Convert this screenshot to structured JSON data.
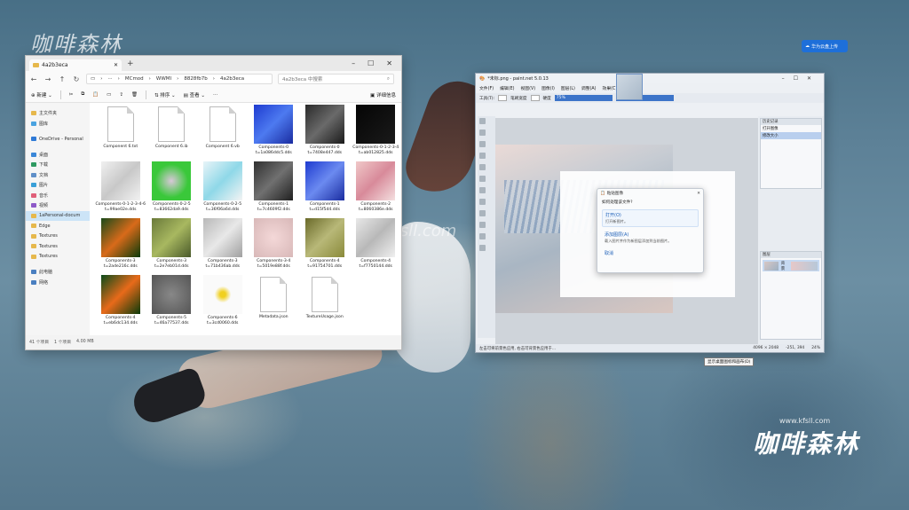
{
  "desktop": {
    "watermark_top_left": "咖啡森林",
    "watermark_center": "kfsll.com",
    "watermark_br_url": "www.kfsll.com",
    "watermark_br_name": "咖啡森林",
    "cloud_button": "华为云盘上传"
  },
  "explorer": {
    "tab_title": "4a2b3eca",
    "breadcrumb": [
      "MCmod",
      "WWMI",
      "8828fb7b",
      "4a2b3eca"
    ],
    "search_placeholder": "4a2b3eca 中搜索",
    "toolbar": {
      "new": "新建",
      "sort": "排序",
      "view": "查看",
      "details": "详细信息"
    },
    "nav": [
      {
        "label": "主文件夹",
        "color": "#e6b84c"
      },
      {
        "label": "图库",
        "color": "#4aa3e0"
      },
      {
        "label": "OneDrive - Personal",
        "color": "#2f7ad6"
      },
      {
        "label": "桌面",
        "color": "#3a87d8"
      },
      {
        "label": "下载",
        "color": "#2f9a62"
      },
      {
        "label": "文档",
        "color": "#5f8fc8"
      },
      {
        "label": "图片",
        "color": "#3aa0d8"
      },
      {
        "label": "音乐",
        "color": "#e0607a"
      },
      {
        "label": "视频",
        "color": "#8e5ac8"
      },
      {
        "label": "1aPersonal-docum",
        "color": "#e6b84c"
      },
      {
        "label": "Edge",
        "color": "#e6b84c"
      },
      {
        "label": "Textures",
        "color": "#e6b84c"
      },
      {
        "label": "Textures",
        "color": "#e6b84c"
      },
      {
        "label": "Textures",
        "color": "#e6b84c"
      },
      {
        "label": "此电脑",
        "color": "#4a7fc0"
      },
      {
        "label": "网络",
        "color": "#4a7fc0"
      }
    ],
    "files": [
      {
        "name": "Component 6.txt",
        "kind": "doc"
      },
      {
        "name": "Component 6.ib",
        "kind": "doc"
      },
      {
        "name": "Component 6.vb",
        "kind": "doc"
      },
      {
        "name": "Components-0 t=1a086ddc5.dds",
        "kind": "thumb",
        "bg": "linear-gradient(135deg,#1e3bd0,#4d7af0,#1a2ca0)"
      },
      {
        "name": "Components-0 t=7408e447.dds",
        "kind": "thumb",
        "bg": "linear-gradient(135deg,#2a2a2a,#6a6a6a,#1a1a1a)"
      },
      {
        "name": "Components-0-1-2-3-4 t=ab012825.dds",
        "kind": "thumb",
        "bg": "linear-gradient(135deg,#050505,#1a1a1a)"
      },
      {
        "name": "Components-0-1-2-3-4-6 t=99ae02e.dds",
        "kind": "thumb",
        "bg": "linear-gradient(135deg,#f0f0f0,#c8c8c8,#f2f2f2)"
      },
      {
        "name": "Components-0-2-5 t=83662da9.dds",
        "kind": "thumb",
        "bg": "radial-gradient(circle at 50% 50%,#d8c8d8,#3ac83a 60%)"
      },
      {
        "name": "Components-0-2-5 t=36f06a6d.dds",
        "kind": "thumb",
        "bg": "linear-gradient(135deg,#e8f4f8,#8fd8e8,#f4f4f4)"
      },
      {
        "name": "Components-1 t=7c4609f2.dds",
        "kind": "thumb",
        "bg": "linear-gradient(135deg,#303030,#707070,#202020)"
      },
      {
        "name": "Components-1 t=d15f5d4.dds",
        "kind": "thumb",
        "bg": "linear-gradient(135deg,#1e3bd0,#6b8af0,#1a2ca0)"
      },
      {
        "name": "Components-2 t=8060386e.dds",
        "kind": "thumb",
        "bg": "linear-gradient(135deg,#f0c8c8,#d88a9a,#f4e0e0)"
      },
      {
        "name": "Components-3 t=2ade216c.dds",
        "kind": "thumb",
        "bg": "linear-gradient(135deg,#1a4a1a,#d86a1a,#0a3a0a)"
      },
      {
        "name": "Components-3 t=2e7eb01d.dds",
        "kind": "thumb",
        "bg": "linear-gradient(135deg,#6a7a3a,#a8b860,#4a5a2a)"
      },
      {
        "name": "Components-3 t=71b436ab.dds",
        "kind": "thumb",
        "bg": "linear-gradient(135deg,#b8b8b8,#e8e8e8,#a0a0a0)"
      },
      {
        "name": "Components-3-4 t=5019e88f.dds",
        "kind": "thumb",
        "bg": "radial-gradient(circle,#f4d8d8,#d8b8b8)"
      },
      {
        "name": "Components-4 t=91754701.dds",
        "kind": "thumb",
        "bg": "linear-gradient(135deg,#6a6a2a,#b8b878,#8a8a3a)"
      },
      {
        "name": "Components-4 t=f7750144.dds",
        "kind": "thumb",
        "bg": "linear-gradient(135deg,#e8e8e8,#b8b8b8,#f0f0f0)"
      },
      {
        "name": "Components-4 t=eb6dc134.dds",
        "kind": "thumb",
        "bg": "linear-gradient(135deg,#0a4a1a,#e86a1a,#0a3a0a)"
      },
      {
        "name": "Components-5 t=46a77537.dds",
        "kind": "thumb",
        "bg": "radial-gradient(circle,#888,#555)"
      },
      {
        "name": "Components-6 t=3cd0060.dds",
        "kind": "thumb",
        "bg": "radial-gradient(circle,#f0d020 10%,#fafafa 30%)"
      },
      {
        "name": "Metadata.json",
        "kind": "doc"
      },
      {
        "name": "TextureUsage.json",
        "kind": "doc"
      }
    ],
    "status": [
      "41 个项目",
      "1 个项目",
      "4.00 MB"
    ]
  },
  "paint": {
    "title": "*未标.png - paint.net 5.0.13",
    "menu": [
      "文件(F)",
      "编辑(E)",
      "视图(V)",
      "图像(I)",
      "图层(L)",
      "调整(A)",
      "效果(C)"
    ],
    "tools_label": "工具(T):",
    "brush_label": "笔刷宽度",
    "zoom_bar": "75%",
    "antialias": "硬度",
    "fill_bar": "75%",
    "history_title": "历史记录",
    "history": [
      "打开图像",
      "修改大小"
    ],
    "layers_title": "图层",
    "layer_name": "背景",
    "status_left": "左击可将前景色应用, 右击可背景色应用于...",
    "status_size": "4096 × 2048",
    "status_pos": "-251, 394",
    "status_zoom": "24%"
  },
  "dialog": {
    "title": "粘贴图像",
    "question": "如何处理该文件?",
    "options": [
      {
        "main": "打开(O)",
        "sub": "打开新图片。",
        "hl": true
      },
      {
        "main": "添加图层(A)",
        "sub": "载入图片并作为新图层添加到当前图片。",
        "hl": false
      },
      {
        "main": "取消",
        "sub": "",
        "hl": false
      }
    ]
  },
  "tooltip": "显示桌面图标和画布(D)"
}
